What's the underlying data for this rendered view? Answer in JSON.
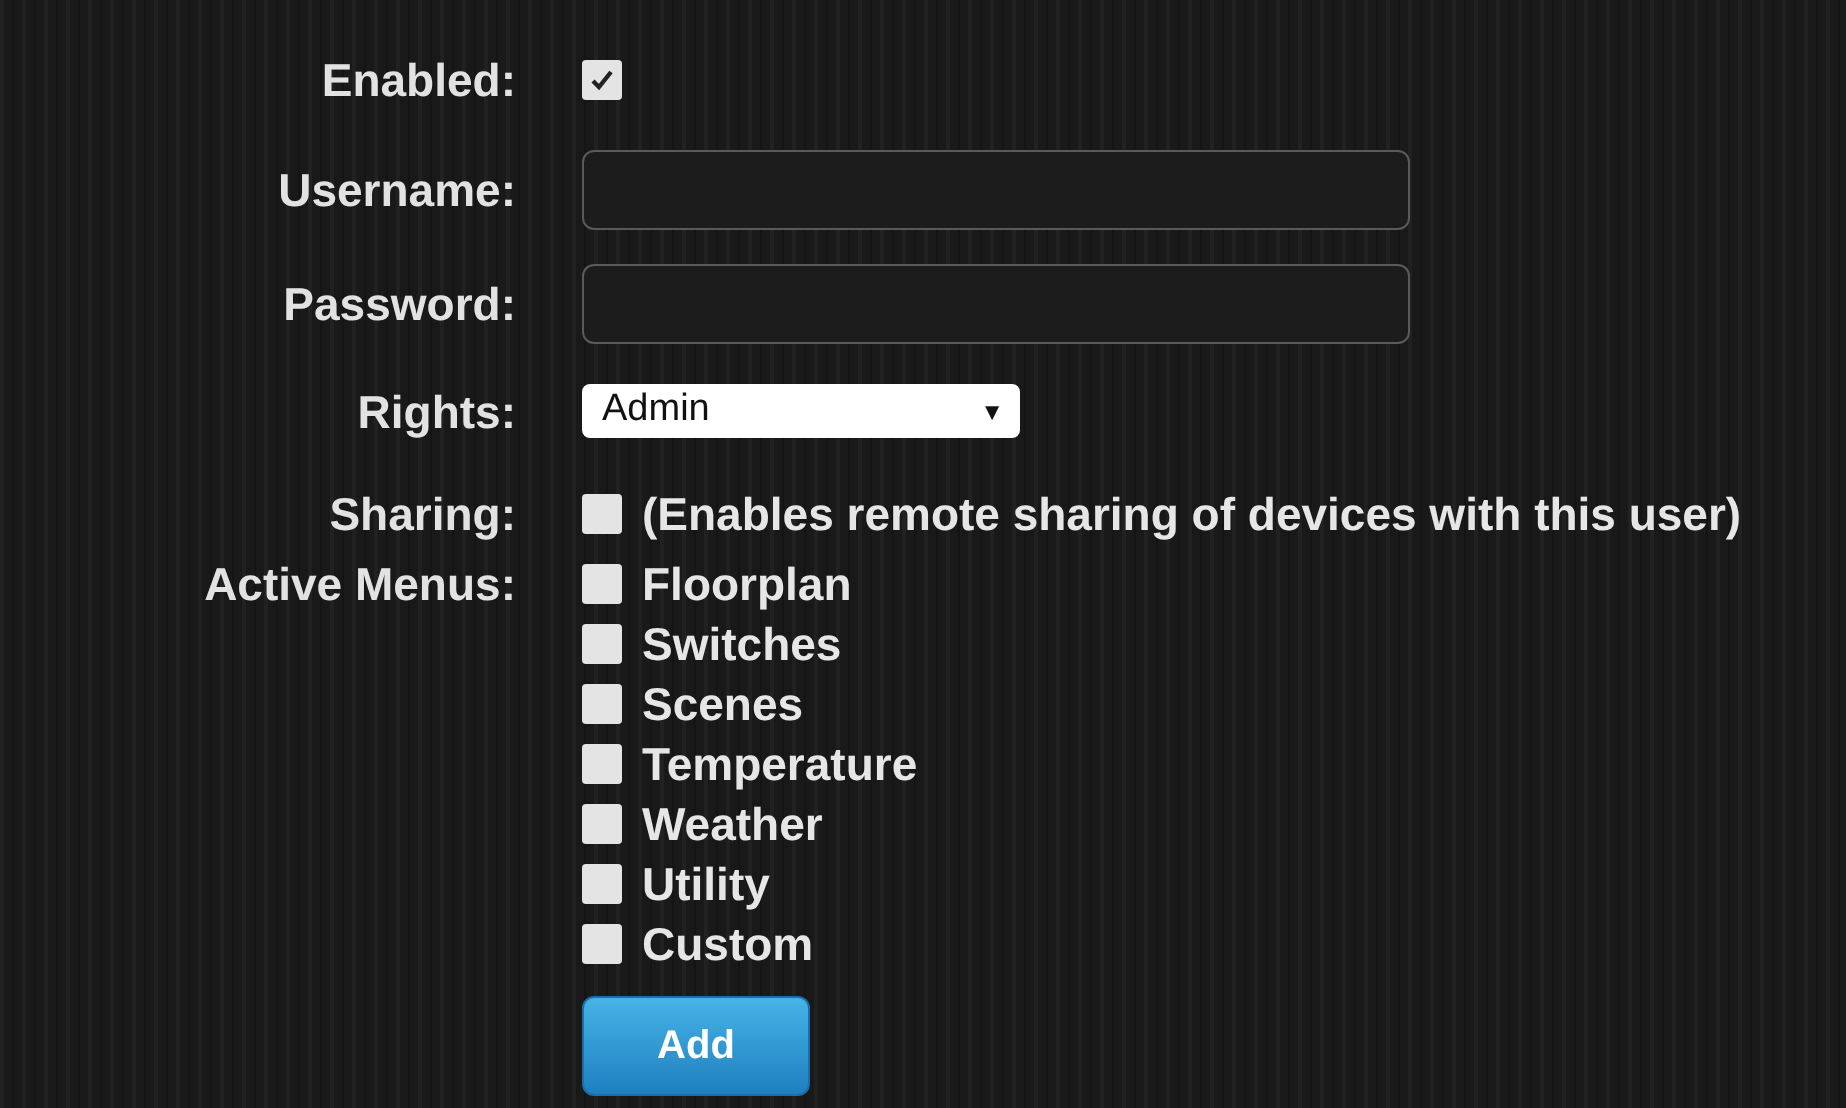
{
  "enabled": {
    "label": "Enabled:",
    "checked": true
  },
  "username": {
    "label": "Username:"
  },
  "password": {
    "label": "Password:"
  },
  "rights": {
    "label": "Rights:",
    "value": "Admin",
    "caret": "▼"
  },
  "sharing": {
    "label": "Sharing:",
    "checked": false,
    "text": "(Enables remote sharing of devices with this user)"
  },
  "active_menus": {
    "label": "Active Menus:",
    "items": [
      {
        "label": "Floorplan",
        "checked": false
      },
      {
        "label": "Switches",
        "checked": false
      },
      {
        "label": "Scenes",
        "checked": false
      },
      {
        "label": "Temperature",
        "checked": false
      },
      {
        "label": "Weather",
        "checked": false
      },
      {
        "label": "Utility",
        "checked": false
      },
      {
        "label": "Custom",
        "checked": false
      }
    ]
  },
  "add_button": {
    "label": "Add"
  }
}
